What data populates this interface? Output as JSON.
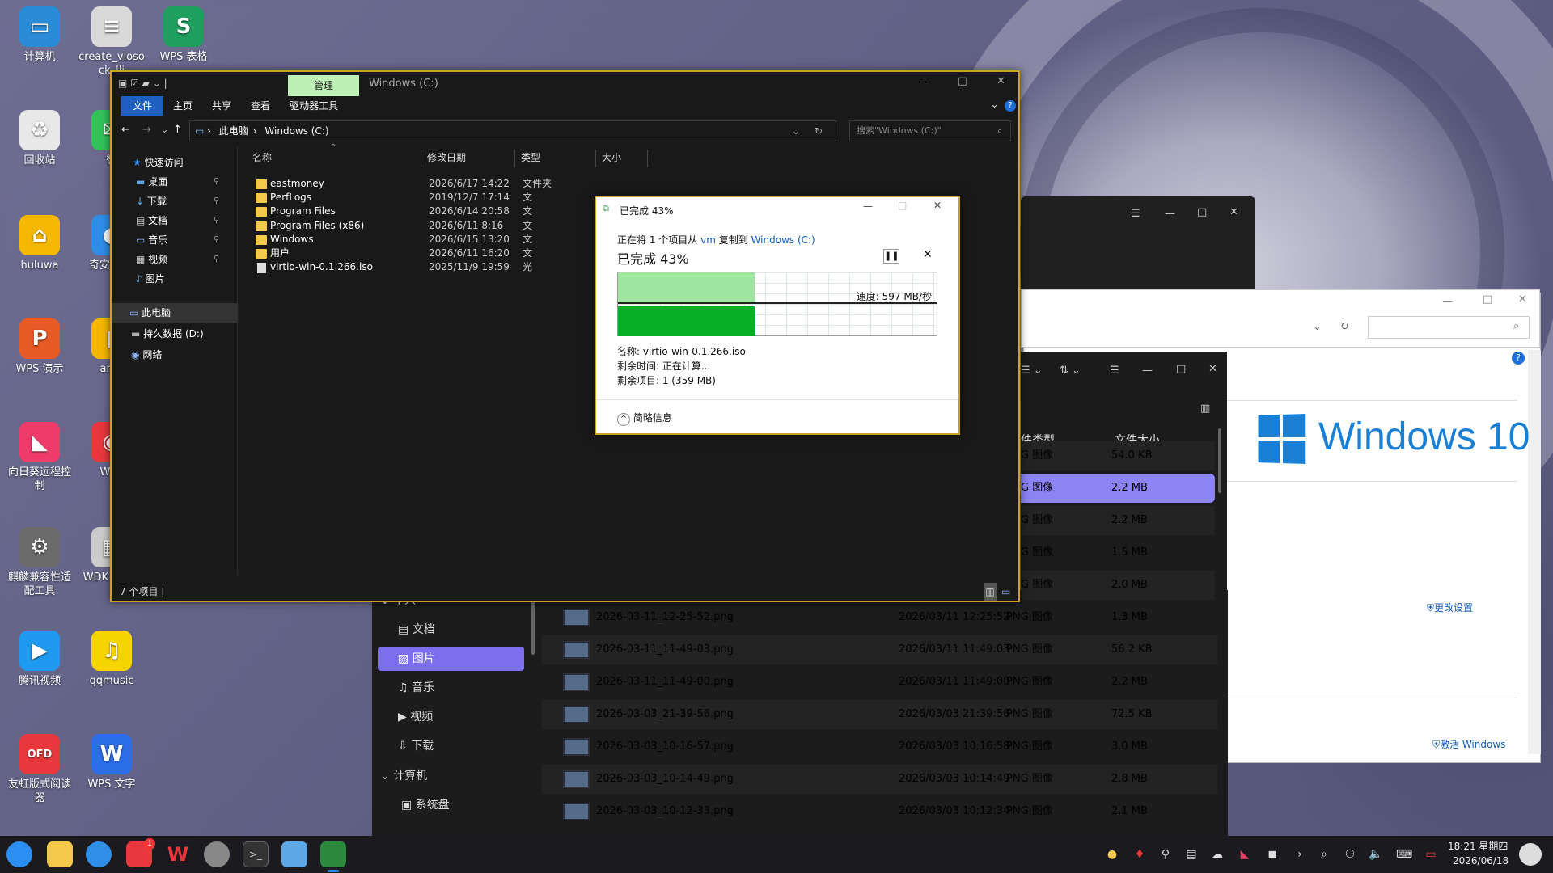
{
  "desktop": {
    "icons": [
      {
        "label": "计算机",
        "color": "#2a8cd8",
        "glyph": "▭"
      },
      {
        "label": "create_vioso ck_lli",
        "color": "#d9d9d9",
        "glyph": "≡"
      },
      {
        "label": "WPS 表格",
        "color": "#1fa05f",
        "glyph": "S"
      },
      {
        "label": "回收站",
        "color": "#e8e8e8",
        "glyph": "♻"
      },
      {
        "label": "微",
        "color": "#33c25a",
        "glyph": "✉"
      },
      {
        "label": "huluwa",
        "color": "#f5b800",
        "glyph": "⌂"
      },
      {
        "label": "奇安信 览",
        "color": "#2f8fe8",
        "glyph": "◐"
      },
      {
        "label": "WPS 演示",
        "color": "#e85a26",
        "glyph": "P"
      },
      {
        "label": "amd",
        "color": "#f5b800",
        "glyph": "▮"
      },
      {
        "label": "向日葵远程控制",
        "color": "#ef3b6a",
        "glyph": "◣"
      },
      {
        "label": "WPS",
        "color": "#e8383d",
        "glyph": "◉"
      },
      {
        "label": "麒麟兼容性适配工具",
        "color": "#6b6b6b",
        "glyph": "⚙"
      },
      {
        "label": "WDK Targe",
        "color": "#cccccc",
        "glyph": "▦"
      },
      {
        "label": "腾讯视频",
        "color": "#1e9bf0",
        "glyph": "▶"
      },
      {
        "label": "qqmusic",
        "color": "#f5d400",
        "glyph": "♫"
      },
      {
        "label": "友虹版式阅读器",
        "color": "#e8383d",
        "glyph": "OFD"
      },
      {
        "label": "WPS 文字",
        "color": "#2c6de8",
        "glyph": "W"
      }
    ]
  },
  "explorer": {
    "ribbon_context_tab": "管理",
    "title": "Windows (C:)",
    "menu": [
      "文件",
      "主页",
      "共享",
      "查看",
      "驱动器工具"
    ],
    "breadcrumb": [
      "此电脑",
      "Windows (C:)"
    ],
    "search_placeholder": "搜索\"Windows (C:)\"",
    "nav": {
      "quick_access": "快速访问",
      "quick_items": [
        "桌面",
        "下载",
        "文档",
        "音乐",
        "视频",
        "图片"
      ],
      "this_pc": "此电脑",
      "drive_d": "持久数据 (D:)",
      "network": "网络"
    },
    "columns": [
      "名称",
      "修改日期",
      "类型",
      "大小"
    ],
    "rows": [
      {
        "name": "eastmoney",
        "date": "2026/6/17 14:22",
        "type": "文件夹",
        "kind": "folder"
      },
      {
        "name": "PerfLogs",
        "date": "2019/12/7 17:14",
        "type": "文",
        "kind": "folder"
      },
      {
        "name": "Program Files",
        "date": "2026/6/14 20:58",
        "type": "文",
        "kind": "folder"
      },
      {
        "name": "Program Files (x86)",
        "date": "2026/6/11 8:16",
        "type": "文",
        "kind": "folder"
      },
      {
        "name": "Windows",
        "date": "2026/6/15 13:20",
        "type": "文",
        "kind": "folder"
      },
      {
        "name": "用户",
        "date": "2026/6/11 16:20",
        "type": "文",
        "kind": "folder"
      },
      {
        "name": "virtio-win-0.1.266.iso",
        "date": "2025/11/9 19:59",
        "type": "光",
        "kind": "file"
      }
    ],
    "status": "7 个项目"
  },
  "copy_dialog": {
    "title": "已完成 43%",
    "desc_prefix": "正在将 1 个项目从",
    "src": "vm",
    "desc_mid": "复制到",
    "dest": "Windows (C:)",
    "heading": "已完成 43%",
    "progress": 0.43,
    "speed": "速度: 597 MB/秒",
    "name_line": "名称: virtio-win-0.1.266.iso",
    "time_line": "剩余时间: 正在计算...",
    "items_line": "剩余项目: 1 (359 MB)",
    "details": "简略信息"
  },
  "file_manager": {
    "col_type": "件类型",
    "col_size": "文件大小",
    "side": [
      "个人",
      "文档",
      "图片",
      "音乐",
      "视频",
      "下载",
      "计算机",
      "系统盘"
    ],
    "rows": [
      {
        "name": "",
        "date": "",
        "type": "G 图像",
        "size": "54.0 KB",
        "selected": false
      },
      {
        "name": "",
        "date": "",
        "type": "G 图像",
        "size": "2.2 MB",
        "selected": true
      },
      {
        "name": "",
        "date": "",
        "type": "G 图像",
        "size": "2.2 MB",
        "selected": false
      },
      {
        "name": "",
        "date": "",
        "type": "G 图像",
        "size": "1.5 MB",
        "selected": false
      },
      {
        "name": "",
        "date": "",
        "type": "G 图像",
        "size": "2.0 MB",
        "selected": false
      },
      {
        "name": "2026-03-11_12-25-52.png",
        "date": "2026/03/11 12:25:52",
        "type": "PNG 图像",
        "size": "1.3 MB",
        "selected": false
      },
      {
        "name": "2026-03-11_11-49-03.png",
        "date": "2026/03/11 11:49:03",
        "type": "PNG 图像",
        "size": "56.2 KB",
        "selected": false
      },
      {
        "name": "2026-03-11_11-49-00.png",
        "date": "2026/03/11 11:49:00",
        "type": "PNG 图像",
        "size": "2.2 MB",
        "selected": false
      },
      {
        "name": "2026-03-03_21-39-56.png",
        "date": "2026/03/03 21:39:56",
        "type": "PNG 图像",
        "size": "72.5 KB",
        "selected": false
      },
      {
        "name": "2026-03-03_10-16-57.png",
        "date": "2026/03/03 10:16:58",
        "type": "PNG 图像",
        "size": "3.0 MB",
        "selected": false
      },
      {
        "name": "2026-03-03_10-14-49.png",
        "date": "2026/03/03 10:14:49",
        "type": "PNG 图像",
        "size": "2.8 MB",
        "selected": false
      },
      {
        "name": "2026-03-03_10-12-33.png",
        "date": "2026/03/03 10:12:34",
        "type": "PNG 图像",
        "size": "2.1 MB",
        "selected": false
      }
    ]
  },
  "about_windows": {
    "brand": "Windows 10",
    "change_settings": "更改设置",
    "activate": "激活 Windows"
  },
  "taskbar": {
    "time": "18:21 星期四",
    "date": "2026/06/18",
    "badge": "1"
  }
}
